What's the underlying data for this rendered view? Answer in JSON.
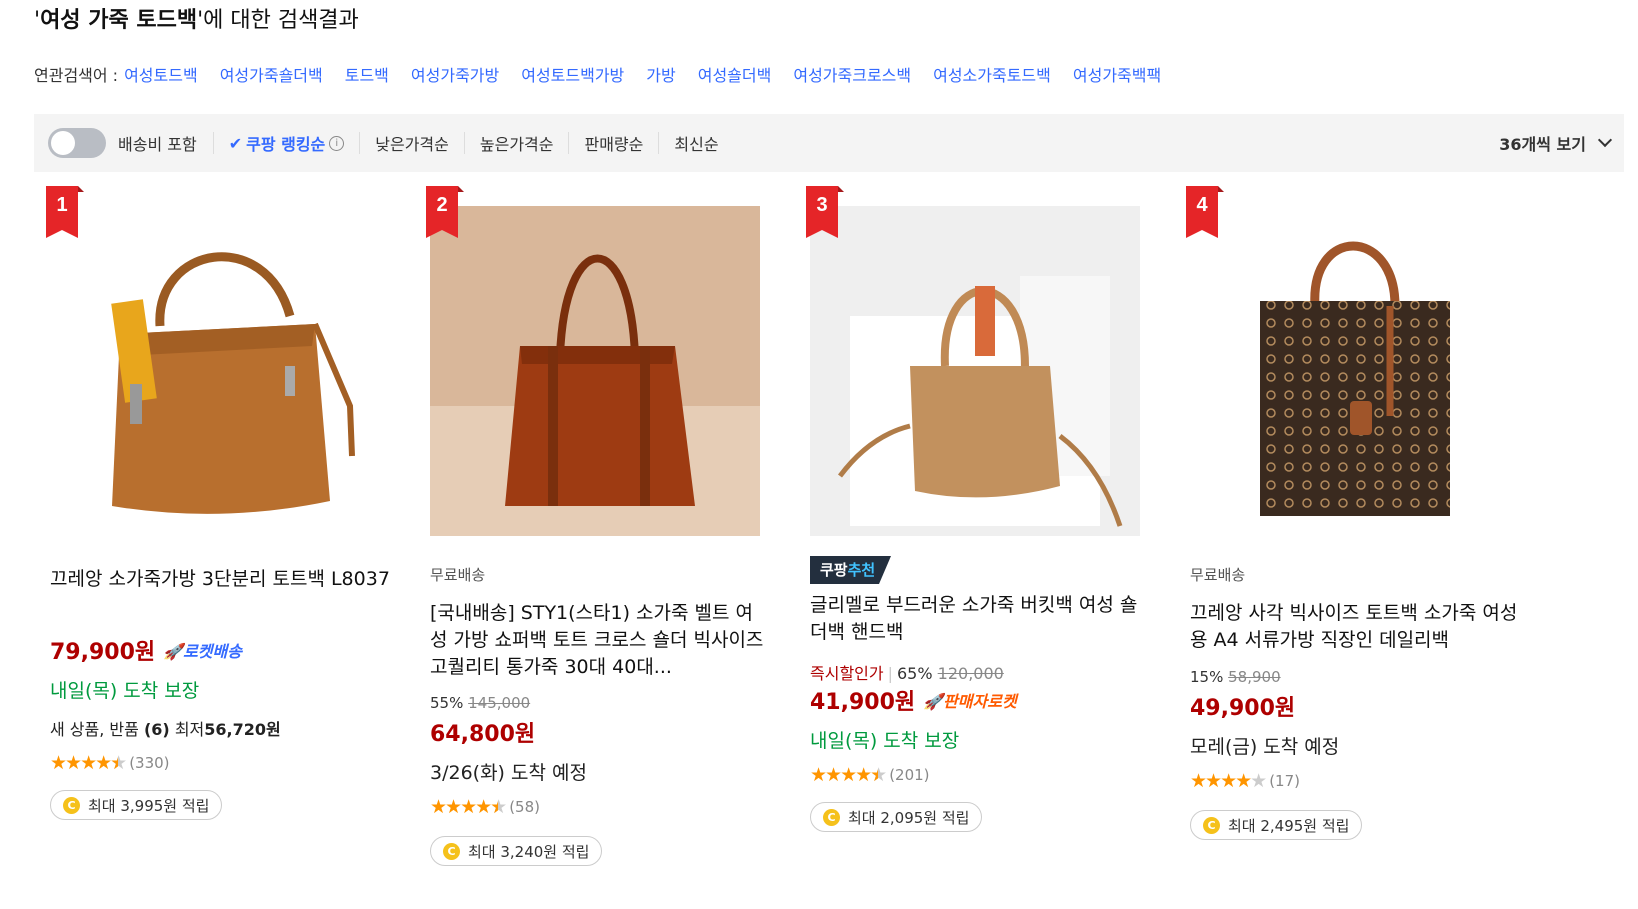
{
  "search": {
    "query": "여성 가죽 토드백",
    "title_suffix": "에 대한 검색결과"
  },
  "related": {
    "label": "연관검색어 :",
    "terms": [
      "여성토드백",
      "여성가죽숄더백",
      "토드백",
      "여성가죽가방",
      "여성토드백가방",
      "가방",
      "여성숄더백",
      "여성가죽크로스백",
      "여성소가죽토드백",
      "여성가죽백팩"
    ]
  },
  "sortbar": {
    "shipping_toggle_label": "배송비 포함",
    "active_sort": "쿠팡 랭킹순",
    "sorts": [
      "낮은가격순",
      "높은가격순",
      "판매량순",
      "최신순"
    ],
    "view_count": "36개씩 보기"
  },
  "products": [
    {
      "rank": "1",
      "name": "끄레앙 소가죽가방 3단분리 토트백 L8037",
      "price": "79,900원",
      "delivery_badge": "로켓배송",
      "arrival": "내일(목) 도착 보장",
      "used_label": "새 상품, 반품",
      "used_count": "(6)",
      "used_min_label": "최저",
      "used_min_price": "56,720원",
      "rating": 4.5,
      "review_count": "(330)",
      "reward": "최대 3,995원 적립"
    },
    {
      "rank": "2",
      "free_shipping": "무료배송",
      "name": "[국내배송] STY1(스타1) 소가죽 벨트 여성 가방 쇼퍼백 토트 크로스 숄더 빅사이즈 고퀄리티 통가죽 30대 40대...",
      "discount": "55%",
      "original_price": "145,000",
      "price": "64,800원",
      "arrival": "3/26(화) 도착 예정",
      "rating": 4.5,
      "review_count": "(58)",
      "reward": "최대 3,240원 적립"
    },
    {
      "rank": "3",
      "badge_prefix": "쿠팡",
      "badge_suffix": "추천",
      "name": "글리멜로 부드러운 소가죽 버킷백 여성 숄더백 핸드백",
      "instant_label": "즉시할인가",
      "discount": "65%",
      "original_price": "120,000",
      "price": "41,900원",
      "delivery_badge": "판매자로켓",
      "arrival": "내일(목) 도착 보장",
      "rating": 4.5,
      "review_count": "(201)",
      "reward": "최대 2,095원 적립"
    },
    {
      "rank": "4",
      "free_shipping": "무료배송",
      "name": "끄레앙 사각 빅사이즈 토트백 소가죽 여성용 A4 서류가방 직장인 데일리백",
      "discount": "15%",
      "original_price": "58,900",
      "price": "49,900원",
      "arrival": "모레(금) 도착 예정",
      "rating": 4,
      "review_count": "(17)",
      "reward": "최대 2,495원 적립"
    }
  ],
  "colors": {
    "link_blue": "#346aff",
    "price_red": "#ae0000",
    "arrival_green": "#009a3e",
    "rank_red": "#e52528",
    "star_orange": "#ff9500"
  }
}
